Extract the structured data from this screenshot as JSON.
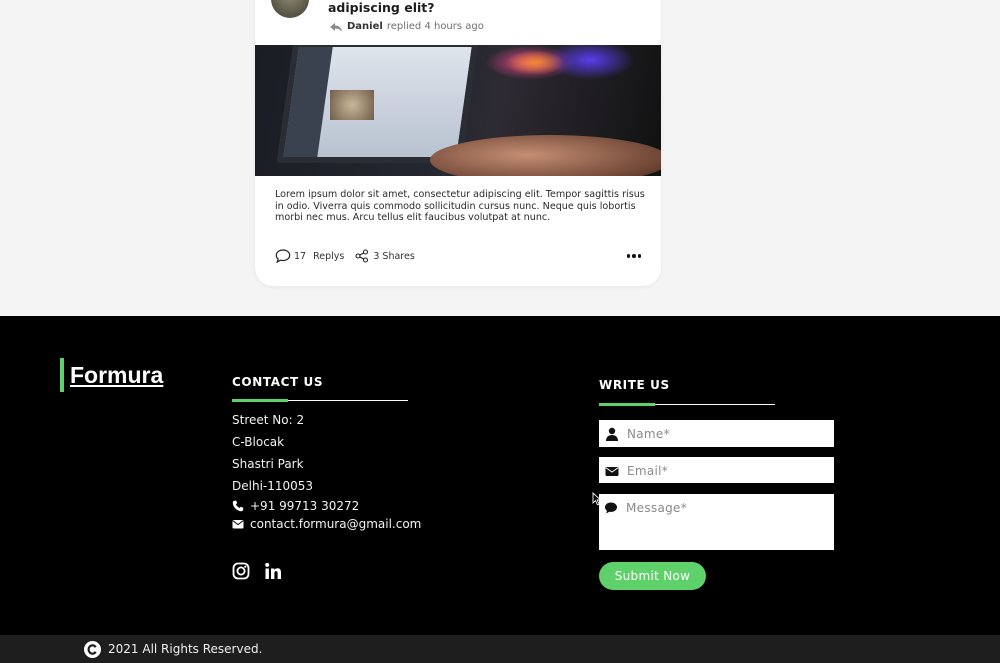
{
  "post": {
    "title": "adipiscing elit?",
    "author": "Daniel",
    "meta_suffix": "replied 4 hours ago",
    "body": "Lorem ipsum dolor sit amet, consectetur adipiscing elit. Tempor sagittis risus in odio. Viverra quis commodo sollicitudin cursus nunc. Neque quis lobortis morbi nec mus. Arcu tellus elit faucibus volutpat at nunc.",
    "replies_count": "17",
    "replies_label": "Replys",
    "shares_label": "3 Shares"
  },
  "footer": {
    "logo": "Formura",
    "contact": {
      "title": "CONTACT US",
      "address_lines": [
        "Street No: 2",
        "C-Blocak",
        "Shastri Park",
        "Delhi-110053"
      ],
      "phone": "+91 99713 30272",
      "email": "contact.formura@gmail.com"
    },
    "social": [
      "instagram-icon",
      "linkedin-icon"
    ],
    "write_us": {
      "title": "WRITE US",
      "name_placeholder": "Name*",
      "email_placeholder": "Email*",
      "message_placeholder": "Message*",
      "submit_label": "Submit Now"
    },
    "copyright": "2021 All Rights Reserved."
  },
  "colors": {
    "accent": "#5fd16b",
    "footer_bg": "#000000",
    "page_bg": "#f4f4f4"
  }
}
